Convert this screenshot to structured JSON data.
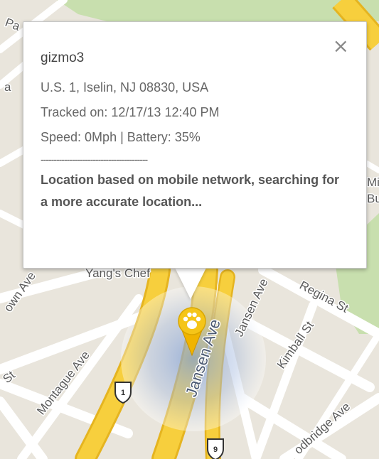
{
  "map": {
    "street_labels": [
      "Jansen Ave",
      "Jansen Ave",
      "Regina St",
      "Kimball St",
      "Montague Ave",
      "odbridge Ave",
      "own Ave",
      "St",
      "Yang's Chef",
      "Mi",
      "Bu",
      "Pa",
      "a"
    ],
    "shields": [
      "1",
      "9"
    ],
    "colors": {
      "land": "#e9e5dc",
      "street": "#ffffff",
      "highway": "#f7cf3d",
      "park": "#c8dfae",
      "accuracy_circle": "#8fa8d6",
      "marker": "#f5c518"
    },
    "marker_icon": "paw-icon"
  },
  "popup": {
    "device_name": "gizmo3",
    "address": "U.S. 1, Iselin, NJ 08830, USA",
    "tracked_on": "Tracked on: 12/17/13 12:40 PM",
    "speed_battery": "Speed: 0Mph | Battery: 35%",
    "separator": "-----------------------------------------",
    "status_message": "Location based on mobile network, searching for a more accurate location...",
    "close_symbol": "×"
  }
}
